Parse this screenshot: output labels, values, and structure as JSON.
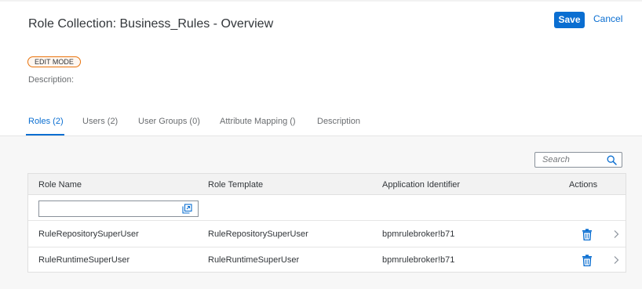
{
  "page": {
    "title": "Role Collection: Business_Rules - Overview",
    "save_label": "Save",
    "cancel_label": "Cancel",
    "mode_badge": "EDIT MODE",
    "description_label": "Description:"
  },
  "tabs": [
    {
      "label": "Roles (2)",
      "active": true
    },
    {
      "label": "Users (2)",
      "active": false
    },
    {
      "label": "User Groups (0)",
      "active": false
    },
    {
      "label": "Attribute Mapping ()",
      "active": false
    },
    {
      "label": "Description",
      "active": false
    }
  ],
  "search": {
    "placeholder": "Search"
  },
  "table": {
    "columns": [
      "Role Name",
      "Role Template",
      "Application Identifier",
      "Actions"
    ],
    "filter_value": "",
    "rows": [
      {
        "role_name": "RuleRepositorySuperUser",
        "role_template": "RuleRepositorySuperUser",
        "app_id": "bpmrulebroker!b71"
      },
      {
        "role_name": "RuleRuntimeSuperUser",
        "role_template": "RuleRuntimeSuperUser",
        "app_id": "bpmrulebroker!b71"
      }
    ]
  },
  "icons": {
    "search": "search-icon",
    "value_help": "value-help-icon",
    "delete": "trash-icon",
    "navigate": "chevron-right-icon"
  },
  "colors": {
    "accent": "#0a6ed1",
    "badge_border": "#e9730c",
    "delete_icon": "#0a6ed1"
  }
}
